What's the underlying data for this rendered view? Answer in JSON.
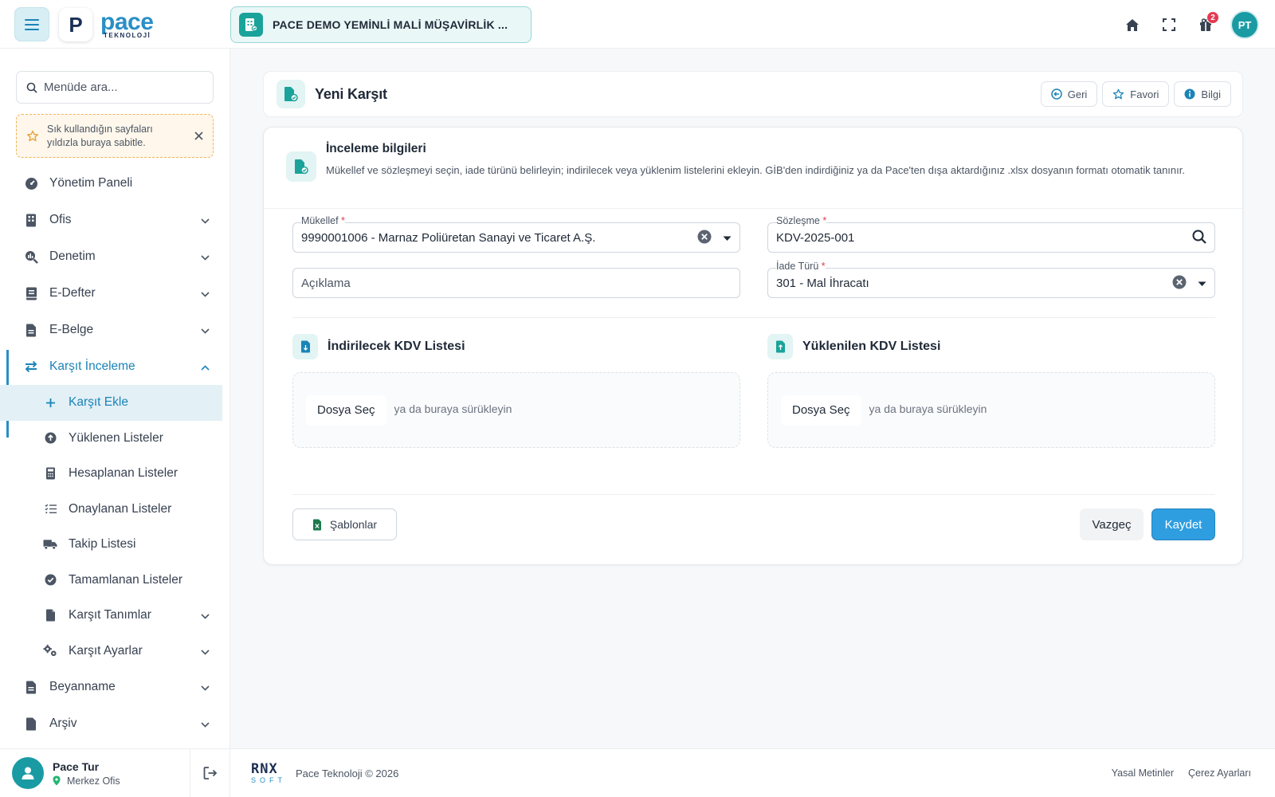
{
  "topbar": {
    "logo_letter": "P",
    "logo_word": "pace",
    "logo_sub": "TEKNOLOJİ",
    "company_name": "PACE DEMO YEMİNLİ MALİ MÜŞAVİRLİK ...",
    "notification_count": "2",
    "user_initials": "PT"
  },
  "sidebar": {
    "search_placeholder": "Menüde ara...",
    "tip_text": "Sık kullandığın sayfaları yıldızla buraya sabitle.",
    "items": [
      {
        "label": "Yönetim Paneli"
      },
      {
        "label": "Ofis"
      },
      {
        "label": "Denetim"
      },
      {
        "label": "E-Defter"
      },
      {
        "label": "E-Belge"
      },
      {
        "label": "Karşıt İnceleme"
      },
      {
        "label": "Beyanname"
      },
      {
        "label": "Arşiv"
      }
    ],
    "sub_items": [
      {
        "label": "Karşıt Ekle"
      },
      {
        "label": "Yüklenen Listeler"
      },
      {
        "label": "Hesaplanan Listeler"
      },
      {
        "label": "Onaylanan Listeler"
      },
      {
        "label": "Takip Listesi"
      },
      {
        "label": "Tamamlanan Listeler"
      },
      {
        "label": "Karşıt Tanımlar"
      },
      {
        "label": "Karşıt Ayarlar"
      }
    ],
    "user": {
      "name": "Pace Tur",
      "office": "Merkez Ofis"
    }
  },
  "page": {
    "title": "Yeni Karşıt",
    "actions": {
      "back": "Geri",
      "favorite": "Favori",
      "info": "Bilgi"
    }
  },
  "card": {
    "title": "İnceleme bilgileri",
    "description": "Mükellef ve sözleşmeyi seçin, iade türünü belirleyin; indirilecek veya yüklenim listelerini ekleyin. GİB'den indirdiğiniz ya da Pace'ten dışa aktardığınız .xlsx dosyanın formatı otomatik tanınır.",
    "fields": {
      "taxpayer_label": "Mükellef",
      "taxpayer_value": "9990001006 - Marnaz Poliüretan Sanayi ve Ticaret A.Ş.",
      "contract_label": "Sözleşme",
      "contract_value": "KDV-2025-001",
      "description_placeholder": "Açıklama",
      "refund_type_label": "İade Türü",
      "refund_type_value": "301 - Mal İhracatı",
      "required_mark": "*"
    },
    "lists": {
      "deductible_title": "İndirilecek KDV Listesi",
      "loaded_title": "Yüklenilen KDV Listesi",
      "choose_file": "Dosya Seç",
      "drop_hint": "ya da buraya sürükleyin"
    },
    "buttons": {
      "templates": "Şablonlar",
      "cancel": "Vazgeç",
      "save": "Kaydet"
    }
  },
  "footer": {
    "brand_word": "RNX",
    "brand_sub": "SOFT",
    "copyright": "Pace Teknoloji © 2026",
    "links": [
      "Yasal Metinler",
      "Çerez Ayarları"
    ]
  },
  "colors": {
    "accent": "#2a8fc7",
    "teal": "#1aa39a",
    "danger": "#e53950"
  }
}
